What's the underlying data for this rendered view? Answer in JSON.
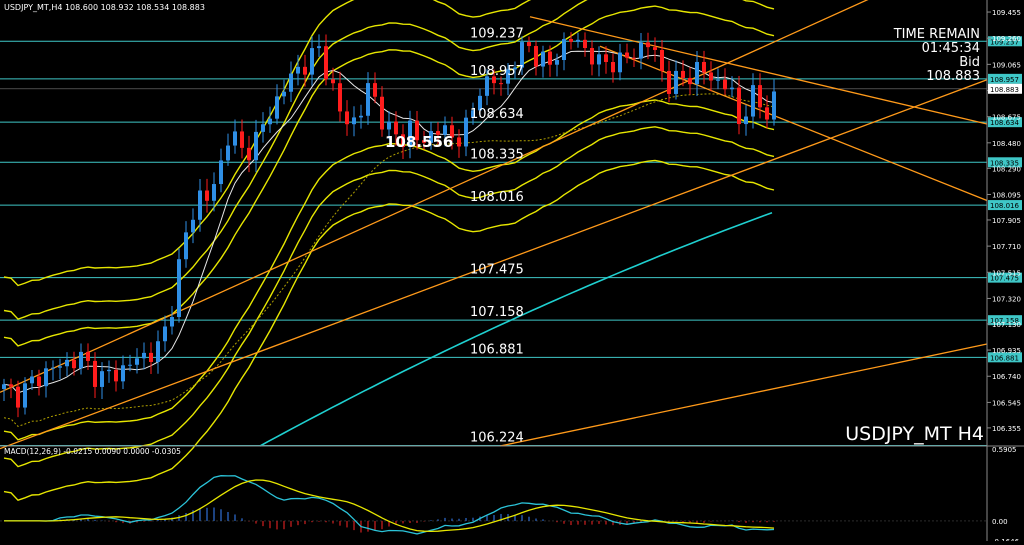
{
  "chart_data": [
    {
      "type": "candlestick",
      "symbol_header": "USDJPY_MT,H4  108.600 108.932 108.534 108.883",
      "watermark": "USDJPY_MT H4",
      "ylim": [
        106.22,
        109.5
      ],
      "y_ticks": [
        "109.455",
        "109.260",
        "109.065",
        "108.870",
        "108.675",
        "108.480",
        "108.290",
        "108.095",
        "107.905",
        "107.710",
        "107.515",
        "107.320",
        "107.130",
        "106.935",
        "106.740",
        "106.545",
        "106.355"
      ],
      "levels": [
        {
          "value": 109.237,
          "label": "109.237",
          "tag": "109.237"
        },
        {
          "value": 108.957,
          "label": "108.957",
          "tag": "108.957"
        },
        {
          "value": 108.634,
          "label": "108.634",
          "tag": "108.634"
        },
        {
          "value": 108.335,
          "label": "108.335",
          "tag": "108.335"
        },
        {
          "value": 108.016,
          "label": "108.016",
          "tag": "108.016"
        },
        {
          "value": 107.475,
          "label": "107.475",
          "tag": "107.475"
        },
        {
          "value": 107.158,
          "label": "107.158",
          "tag": "107.158"
        },
        {
          "value": 106.881,
          "label": "106.881",
          "tag": "106.881"
        },
        {
          "value": 106.224,
          "label": "106.224",
          "tag": ""
        }
      ],
      "bid_tag": "108.883",
      "marked_price": "108.556",
      "info": {
        "time_label": "TIME REMAIN",
        "time_value": "01:45:34",
        "bid_label": "Bid",
        "bid_value": "108.883"
      },
      "colors": {
        "up": "#2f8fe6",
        "down": "#ff1d1d",
        "level": "#3fc7c7",
        "bands": "#e6e600",
        "trend": "#ff9a1a",
        "ma_long": "#1fd0d0",
        "ma_mid": "#e8e8e8",
        "bid": "#ffffff"
      }
    },
    {
      "type": "macd",
      "title": "MACD(12,26,9) -0.0215 0.0090 0.0000 -0.0305",
      "ylim": [
        -0.1646,
        0.5905
      ],
      "y_ticks": [
        "0.5905",
        "0.00",
        "-0.1646"
      ],
      "colors": {
        "macd": "#2bc3d8",
        "signal": "#e6e600",
        "hist_pos": "#2f6fd6",
        "hist_neg": "#d12020"
      }
    }
  ]
}
